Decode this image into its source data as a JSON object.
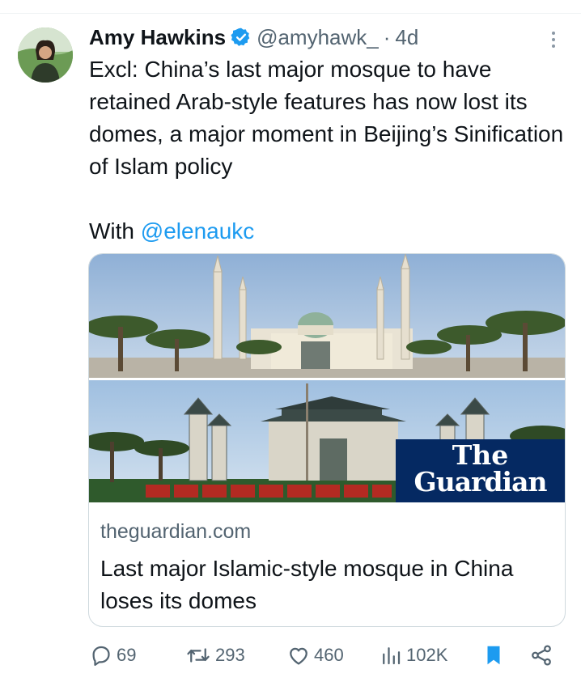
{
  "tweet": {
    "author_name": "Amy Hawkins",
    "handle": "@amyhawk_",
    "separator": "·",
    "time": "4d",
    "text": "Excl: China’s last major mosque to have retained Arab-style features has now lost its domes, a major moment in Beijing’s Sinification of Islam policy",
    "with_prefix": "With ",
    "mention": "@elenaukc"
  },
  "card": {
    "image_logo_line1": "The",
    "image_logo_line2": "Guardian",
    "domain": "theguardian.com",
    "title": "Last major Islamic-style mosque in China loses its domes"
  },
  "actions": {
    "replies": "69",
    "retweets": "293",
    "likes": "460",
    "views": "102K"
  },
  "colors": {
    "accent": "#1d9bf0",
    "muted": "#536471",
    "guardian_blue": "#052962"
  },
  "icons": [
    "verified-badge-icon",
    "more-icon",
    "reply-icon",
    "retweet-icon",
    "like-icon",
    "views-icon",
    "bookmark-icon",
    "share-icon"
  ]
}
